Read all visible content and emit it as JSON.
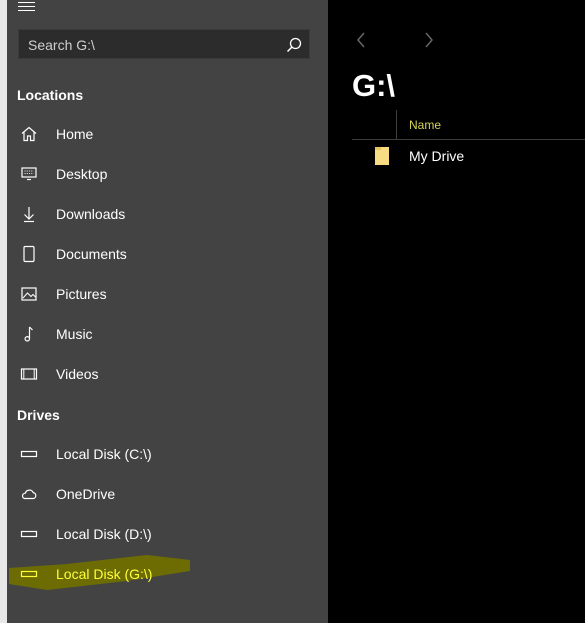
{
  "search": {
    "placeholder": "Search G:\\"
  },
  "sidebar": {
    "locations_header": "Locations",
    "locations": [
      {
        "label": "Home",
        "icon": "home-icon"
      },
      {
        "label": "Desktop",
        "icon": "desktop-icon"
      },
      {
        "label": "Downloads",
        "icon": "download-icon"
      },
      {
        "label": "Documents",
        "icon": "document-icon"
      },
      {
        "label": "Pictures",
        "icon": "picture-icon"
      },
      {
        "label": "Music",
        "icon": "music-icon"
      },
      {
        "label": "Videos",
        "icon": "video-icon"
      }
    ],
    "drives_header": "Drives",
    "drives": [
      {
        "label": "Local Disk (C:\\)",
        "icon": "drive-icon"
      },
      {
        "label": "OneDrive",
        "icon": "cloud-icon"
      },
      {
        "label": "Local Disk (D:\\)",
        "icon": "drive-icon"
      },
      {
        "label": "Local Disk (G:\\)",
        "icon": "drive-icon",
        "selected": true
      }
    ]
  },
  "main": {
    "title": "G:\\",
    "column_name": "Name",
    "files": [
      {
        "name": "My Drive",
        "icon": "folder-icon"
      }
    ]
  },
  "colors": {
    "sidebar_bg": "#434343",
    "main_bg": "#000000",
    "selected_text": "#ffff3a",
    "highlight_marker": "#6f6f00",
    "column_header_text": "#d6d35a"
  }
}
